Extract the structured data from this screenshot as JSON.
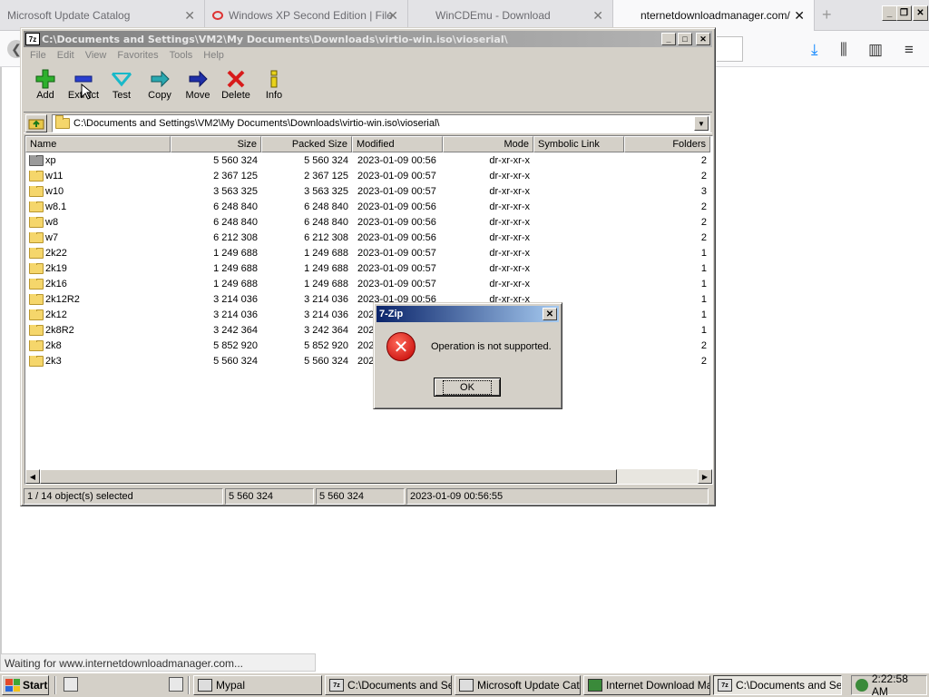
{
  "browser": {
    "tabs": [
      {
        "label": "Microsoft Update Catalog",
        "active": false
      },
      {
        "label": "Windows XP Second Edition | File",
        "active": false
      },
      {
        "label": "WinCDEmu - Download",
        "active": false
      },
      {
        "label": "nternetdownloadmanager.com/do",
        "active": true
      }
    ],
    "status_text": "Waiting for www.internetdownloadmanager.com..."
  },
  "zip": {
    "title": "C:\\Documents and Settings\\VM2\\My Documents\\Downloads\\virtio-win.iso\\vioserial\\",
    "app_icon": "7z",
    "menu": [
      "File",
      "Edit",
      "View",
      "Favorites",
      "Tools",
      "Help"
    ],
    "toolbar": [
      {
        "label": "Add",
        "icon": "add-icon"
      },
      {
        "label": "Extract",
        "icon": "extract-icon"
      },
      {
        "label": "Test",
        "icon": "test-icon"
      },
      {
        "label": "Copy",
        "icon": "copy-icon"
      },
      {
        "label": "Move",
        "icon": "move-icon"
      },
      {
        "label": "Delete",
        "icon": "delete-icon"
      },
      {
        "label": "Info",
        "icon": "info-icon"
      }
    ],
    "path": "C:\\Documents and Settings\\VM2\\My Documents\\Downloads\\virtio-win.iso\\vioserial\\",
    "columns": [
      "Name",
      "Size",
      "Packed Size",
      "Modified",
      "Mode",
      "Symbolic Link",
      "Folders"
    ],
    "rows": [
      {
        "name": "xp",
        "size": "5 560 324",
        "packed": "5 560 324",
        "modified": "2023-01-09 00:56",
        "mode": "dr-xr-xr-x",
        "folders": "2"
      },
      {
        "name": "w11",
        "size": "2 367 125",
        "packed": "2 367 125",
        "modified": "2023-01-09 00:57",
        "mode": "dr-xr-xr-x",
        "folders": "2"
      },
      {
        "name": "w10",
        "size": "3 563 325",
        "packed": "3 563 325",
        "modified": "2023-01-09 00:57",
        "mode": "dr-xr-xr-x",
        "folders": "3"
      },
      {
        "name": "w8.1",
        "size": "6 248 840",
        "packed": "6 248 840",
        "modified": "2023-01-09 00:56",
        "mode": "dr-xr-xr-x",
        "folders": "2"
      },
      {
        "name": "w8",
        "size": "6 248 840",
        "packed": "6 248 840",
        "modified": "2023-01-09 00:56",
        "mode": "dr-xr-xr-x",
        "folders": "2"
      },
      {
        "name": "w7",
        "size": "6 212 308",
        "packed": "6 212 308",
        "modified": "2023-01-09 00:56",
        "mode": "dr-xr-xr-x",
        "folders": "2"
      },
      {
        "name": "2k22",
        "size": "1 249 688",
        "packed": "1 249 688",
        "modified": "2023-01-09 00:57",
        "mode": "dr-xr-xr-x",
        "folders": "1"
      },
      {
        "name": "2k19",
        "size": "1 249 688",
        "packed": "1 249 688",
        "modified": "2023-01-09 00:57",
        "mode": "dr-xr-xr-x",
        "folders": "1"
      },
      {
        "name": "2k16",
        "size": "1 249 688",
        "packed": "1 249 688",
        "modified": "2023-01-09 00:57",
        "mode": "dr-xr-xr-x",
        "folders": "1"
      },
      {
        "name": "2k12R2",
        "size": "3 214 036",
        "packed": "3 214 036",
        "modified": "2023-01-09 00:56",
        "mode": "dr-xr-xr-x",
        "folders": "1"
      },
      {
        "name": "2k12",
        "size": "3 214 036",
        "packed": "3 214 036",
        "modified": "2023",
        "mode": "",
        "folders": "1"
      },
      {
        "name": "2k8R2",
        "size": "3 242 364",
        "packed": "3 242 364",
        "modified": "202",
        "mode": "",
        "folders": "1"
      },
      {
        "name": "2k8",
        "size": "5 852 920",
        "packed": "5 852 920",
        "modified": "202",
        "mode": "",
        "folders": "2"
      },
      {
        "name": "2k3",
        "size": "5 560 324",
        "packed": "5 560 324",
        "modified": "202",
        "mode": "",
        "folders": "2"
      }
    ],
    "status": {
      "selection": "1 / 14 object(s) selected",
      "size": "5 560 324",
      "packed": "5 560 324",
      "modified": "2023-01-09 00:56:55"
    }
  },
  "dialog": {
    "title": "7-Zip",
    "message": "Operation is not supported.",
    "ok_label": "OK"
  },
  "taskbar": {
    "start_label": "Start",
    "tasks": [
      {
        "label": "Mypal",
        "active": false
      },
      {
        "label": "C:\\Documents and Se...",
        "active": false
      },
      {
        "label": "Microsoft Update Cata...",
        "active": false
      },
      {
        "label": "Internet Download Ma...",
        "active": false
      },
      {
        "label": "C:\\Documents and Se...",
        "active": true
      }
    ],
    "clock": "2:22:58 AM"
  }
}
